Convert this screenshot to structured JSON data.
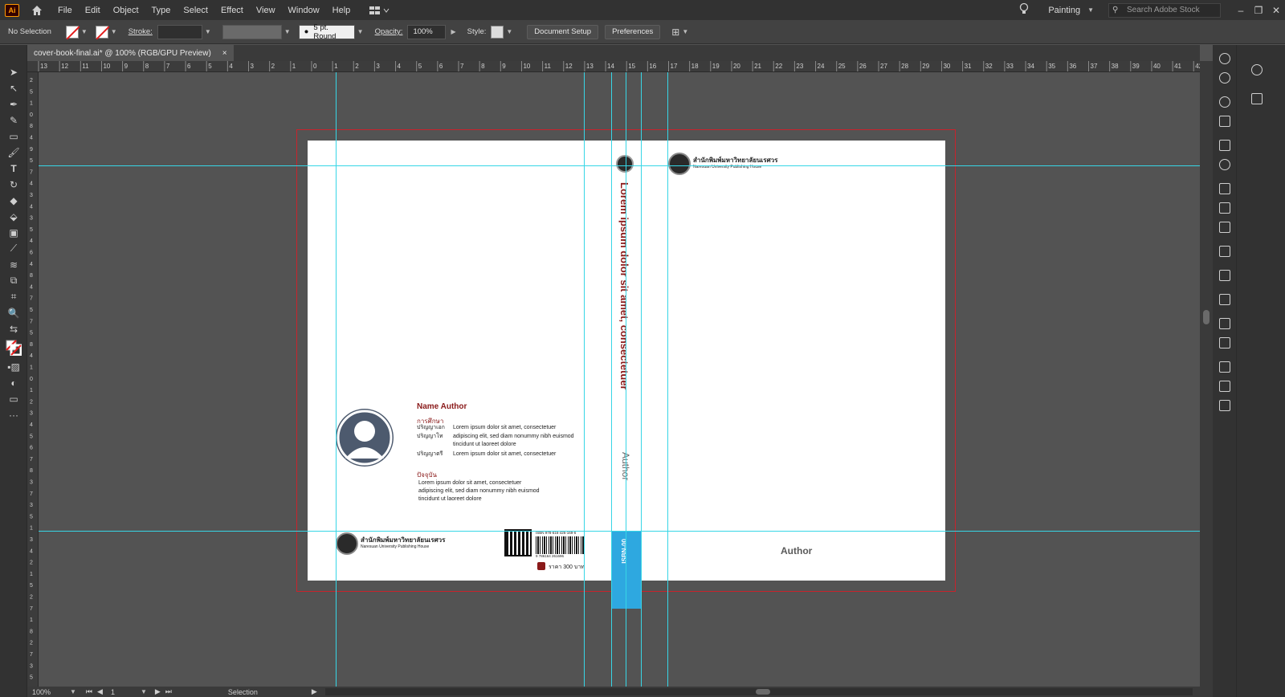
{
  "app": {
    "logo": "Ai"
  },
  "menu": [
    "File",
    "Edit",
    "Object",
    "Type",
    "Select",
    "Effect",
    "View",
    "Window",
    "Help"
  ],
  "workspace": {
    "label": "Painting"
  },
  "search": {
    "placeholder": "Search Adobe Stock"
  },
  "control": {
    "selection": "No Selection",
    "stroke_label": "Stroke:",
    "brush": "5 pt. Round",
    "opacity_label": "Opacity:",
    "opacity_value": "100%",
    "style_label": "Style:",
    "doc_setup": "Document Setup",
    "preferences": "Preferences"
  },
  "tab": {
    "title": "cover-book-final.ai* @ 100% (RGB/GPU Preview)",
    "close": "×"
  },
  "ruler_top": [
    "13",
    "12",
    "11",
    "10",
    "9",
    "8",
    "7",
    "6",
    "5",
    "4",
    "3",
    "2",
    "1",
    "0",
    "1",
    "2",
    "3",
    "4",
    "5",
    "6",
    "7",
    "8",
    "9",
    "10",
    "11",
    "12",
    "13",
    "14",
    "15",
    "16",
    "17",
    "18",
    "19",
    "20",
    "21",
    "22",
    "23",
    "24",
    "25",
    "26",
    "27",
    "28",
    "29",
    "30",
    "31",
    "32",
    "33",
    "34",
    "35",
    "36",
    "37",
    "38",
    "39",
    "40",
    "41",
    "42"
  ],
  "ruler_left": [
    "2",
    "5",
    "1",
    "0",
    "8",
    "4",
    "9",
    "5",
    "7",
    "4",
    "3",
    "4",
    "3",
    "5",
    "4",
    "6",
    "4",
    "8",
    "4",
    "7",
    "5",
    "7",
    "5",
    "8",
    "4",
    "1",
    "0",
    "1",
    "2",
    "3",
    "4",
    "5",
    "6",
    "7",
    "8",
    "3",
    "7",
    "3",
    "5",
    "1",
    "3",
    "4",
    "2",
    "1",
    "5",
    "2",
    "7",
    "1",
    "8",
    "2",
    "7",
    "3",
    "5",
    "5"
  ],
  "cover": {
    "publisher_th": "สำนักพิมพ์มหาวิทยาลัยนเรศวร",
    "publisher_en": "Naresuan University Publishing House",
    "spine_title": "Lorem ipsum dolor sit amet, consectetuer",
    "spine_author": "Author",
    "spine_code": "ISBN-00",
    "front_author": "Author",
    "back": {
      "name_author": "Name Author",
      "education_heading": "การศึกษา",
      "degrees": [
        {
          "label": "ปริญญาเอก",
          "text": "Lorem ipsum dolor sit amet, consectetuer"
        },
        {
          "label": "ปริญญาโท",
          "text": "adipiscing elit, sed diam nonummy nibh euismod"
        },
        {
          "label": "",
          "text": "tincidunt ut laoreet dolore"
        },
        {
          "label": "ปริญญาตรี",
          "text": "Lorem ipsum dolor sit amet, consectetuer"
        }
      ],
      "current_heading": "ปัจจุบัน",
      "current_lines": [
        "Lorem ipsum dolor sit amet, consectetuer",
        "adipiscing elit, sed diam nonummy nibh euismod",
        "tincidunt ut laoreet dolore"
      ],
      "isbn_small": "ISBN 978-616-426-169-6",
      "barcode_number": "9 786164 261696",
      "price": "ราคา 300 บาท"
    }
  },
  "status": {
    "zoom": "100%",
    "page": "1",
    "tool": "Selection"
  },
  "colors": {
    "bleed": "#c8232c",
    "guide": "#37d6e6",
    "spine_blue": "#2ea8e0",
    "accent_red": "#8a1a1a"
  }
}
